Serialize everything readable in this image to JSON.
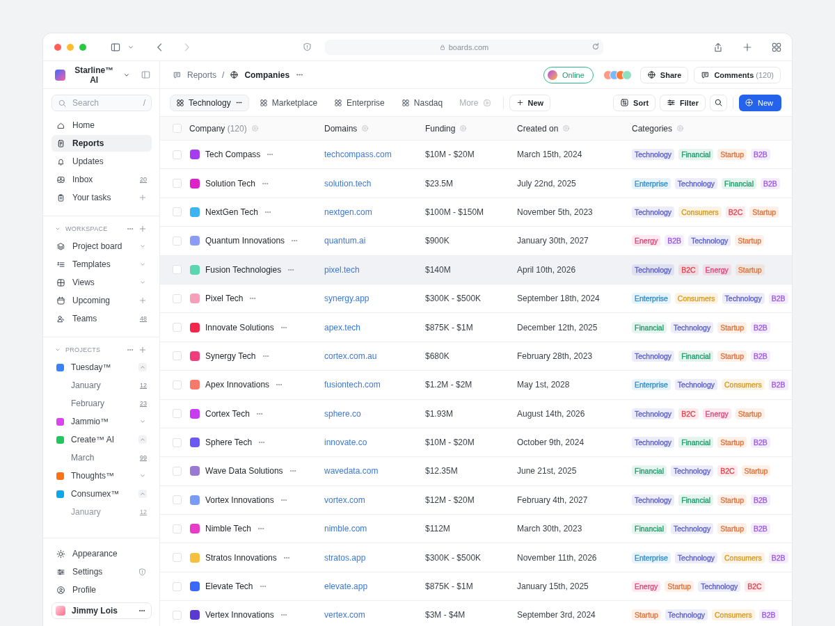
{
  "browser": {
    "url": "boards.com"
  },
  "sidebar": {
    "workspace": "Starline™ AI",
    "search": {
      "placeholder": "Search",
      "shortcut": "/"
    },
    "nav": [
      {
        "label": "Home",
        "selected": false
      },
      {
        "label": "Reports",
        "selected": true
      },
      {
        "label": "Updates",
        "selected": false
      },
      {
        "label": "Inbox",
        "selected": false,
        "count": "20"
      },
      {
        "label": "Your tasks",
        "selected": false,
        "kind": "add"
      }
    ],
    "sections": [
      {
        "title": "WORKSPACE",
        "items": [
          {
            "label": "Project board",
            "kind": "expand"
          },
          {
            "label": "Templates",
            "kind": "expand"
          },
          {
            "label": "Views",
            "kind": "expand"
          },
          {
            "label": "Upcoming",
            "kind": "add"
          },
          {
            "label": "Teams",
            "count": "48"
          }
        ]
      },
      {
        "title": "PROJECTS",
        "projects": [
          {
            "label": "Tuesday™",
            "color": "#3b82f6",
            "expanded": true,
            "children": [
              {
                "label": "January",
                "count": "12"
              },
              {
                "label": "February",
                "count": "23"
              }
            ]
          },
          {
            "label": "Jammio™",
            "color": "#d946ef",
            "expanded": false
          },
          {
            "label": "Create™ AI",
            "color": "#22c55e",
            "expanded": true,
            "children": [
              {
                "label": "March",
                "count": "99"
              }
            ]
          },
          {
            "label": "Thoughts™",
            "color": "#f97316",
            "expanded": false
          },
          {
            "label": "Consumex™",
            "color": "#0ea5e9",
            "expanded": true,
            "children": [
              {
                "label": "January",
                "count": "12"
              }
            ]
          }
        ]
      }
    ],
    "footer": [
      {
        "label": "Appearance"
      },
      {
        "label": "Settings",
        "kind": "secured"
      },
      {
        "label": "Profile"
      }
    ],
    "user": {
      "name": "Jimmy Lois"
    }
  },
  "topbar": {
    "breadcrumbs": [
      {
        "label": "Reports"
      },
      {
        "label": "Companies"
      }
    ],
    "separator": "/",
    "status": "Online",
    "share": "Share",
    "comments": {
      "label": "Comments",
      "count": "(120)"
    }
  },
  "tabs": [
    {
      "label": "Technology",
      "selected": true
    },
    {
      "label": "Marketplace",
      "selected": false
    },
    {
      "label": "Enterprise",
      "selected": false
    },
    {
      "label": "Nasdaq",
      "selected": false
    },
    {
      "label": "More",
      "selected": false,
      "disabled": true
    }
  ],
  "toolbar": {
    "new_view": "New",
    "sort": "Sort",
    "filter": "Filter",
    "primary": "New"
  },
  "table": {
    "columns": [
      {
        "label": "Company",
        "count": "(120)"
      },
      {
        "label": "Domains"
      },
      {
        "label": "Funding"
      },
      {
        "label": "Created on"
      },
      {
        "label": "Categories"
      }
    ],
    "select_all": {
      "checked": false
    },
    "rows": [
      {
        "company": "Tech Compass",
        "color": "#a43cf0",
        "domain": "techcompass.com",
        "funding": "$10M - $20M",
        "created": "March 15th, 2024",
        "selected": false,
        "checked": false,
        "tags": [
          {
            "label": "Technology",
            "color": "#5b5fc7"
          },
          {
            "label": "Financial",
            "color": "#1f9d6b"
          },
          {
            "label": "Startup",
            "color": "#e0723a"
          },
          {
            "label": "B2B",
            "color": "#9b59e0"
          }
        ]
      },
      {
        "company": "Solution Tech",
        "color": "#e020c8",
        "domain": "solution.tech",
        "funding": "$23.5M",
        "created": "July 22nd, 2025",
        "selected": false,
        "checked": false,
        "tags": [
          {
            "label": "Enterprise",
            "color": "#2e8fd0"
          },
          {
            "label": "Technology",
            "color": "#5b5fc7"
          },
          {
            "label": "Financial",
            "color": "#1f9d6b"
          },
          {
            "label": "B2B",
            "color": "#9b59e0"
          }
        ]
      },
      {
        "company": "NextGen Tech",
        "color": "#3cb4f0",
        "domain": "nextgen.com",
        "funding": "$100M - $150M",
        "created": "November 5th, 2023",
        "selected": false,
        "checked": false,
        "tags": [
          {
            "label": "Technology",
            "color": "#5b5fc7"
          },
          {
            "label": "Consumers",
            "color": "#d99a1e"
          },
          {
            "label": "B2C",
            "color": "#e0444f"
          },
          {
            "label": "Startup",
            "color": "#e0723a"
          }
        ]
      },
      {
        "company": "Quantum Innovations",
        "color": "#8a9cf5",
        "domain": "quantum.ai",
        "funding": "$900K",
        "created": "January 30th, 2027",
        "selected": false,
        "checked": false,
        "tags": [
          {
            "label": "Energy",
            "color": "#e0447a"
          },
          {
            "label": "B2B",
            "color": "#9b59e0"
          },
          {
            "label": "Technology",
            "color": "#5b5fc7"
          },
          {
            "label": "Startup",
            "color": "#e0723a"
          }
        ]
      },
      {
        "company": "Fusion Technologies",
        "color": "#5ad6b0",
        "domain": "pixel.tech",
        "funding": "$140M",
        "created": "April 10th, 2026",
        "selected": true,
        "checked": false,
        "tags": [
          {
            "label": "Technology",
            "color": "#5b5fc7"
          },
          {
            "label": "B2C",
            "color": "#e0444f"
          },
          {
            "label": "Energy",
            "color": "#e0447a"
          },
          {
            "label": "Startup",
            "color": "#e0723a"
          }
        ]
      },
      {
        "company": "Pixel Tech",
        "color": "#f5a0b8",
        "domain": "synergy.app",
        "funding": "$300K - $500K",
        "created": "September 18th, 2024",
        "selected": false,
        "checked": false,
        "tags": [
          {
            "label": "Enterprise",
            "color": "#2e8fd0"
          },
          {
            "label": "Consumers",
            "color": "#d99a1e"
          },
          {
            "label": "Technology",
            "color": "#5b5fc7"
          },
          {
            "label": "B2B",
            "color": "#9b59e0"
          }
        ]
      },
      {
        "company": "Innovate Solutions",
        "color": "#f0284a",
        "domain": "apex.tech",
        "funding": "$875K - $1M",
        "created": "December 12th, 2025",
        "selected": false,
        "checked": false,
        "tags": [
          {
            "label": "Financial",
            "color": "#1f9d6b"
          },
          {
            "label": "Technology",
            "color": "#5b5fc7"
          },
          {
            "label": "Startup",
            "color": "#e0723a"
          },
          {
            "label": "B2B",
            "color": "#9b59e0"
          }
        ]
      },
      {
        "company": "Synergy Tech",
        "color": "#f03c78",
        "domain": "cortex.com.au",
        "funding": "$680K",
        "created": "February 28th, 2023",
        "selected": false,
        "checked": false,
        "tags": [
          {
            "label": "Technology",
            "color": "#5b5fc7"
          },
          {
            "label": "Financial",
            "color": "#1f9d6b"
          },
          {
            "label": "Startup",
            "color": "#e0723a"
          },
          {
            "label": "B2B",
            "color": "#9b59e0"
          }
        ]
      },
      {
        "company": "Apex Innovations",
        "color": "#f57a6a",
        "domain": "fusiontech.com",
        "funding": "$1.2M - $2M",
        "created": "May 1st, 2028",
        "selected": false,
        "checked": false,
        "tags": [
          {
            "label": "Enterprise",
            "color": "#2e8fd0"
          },
          {
            "label": "Technology",
            "color": "#5b5fc7"
          },
          {
            "label": "Consumers",
            "color": "#d99a1e"
          },
          {
            "label": "B2B",
            "color": "#9b59e0"
          }
        ]
      },
      {
        "company": "Cortex Tech",
        "color": "#c83cf0",
        "domain": "sphere.co",
        "funding": "$1.93M",
        "created": "August 14th, 2026",
        "selected": false,
        "checked": false,
        "tags": [
          {
            "label": "Technology",
            "color": "#5b5fc7"
          },
          {
            "label": "B2C",
            "color": "#e0444f"
          },
          {
            "label": "Energy",
            "color": "#e0447a"
          },
          {
            "label": "Startup",
            "color": "#e0723a"
          }
        ]
      },
      {
        "company": "Sphere Tech",
        "color": "#6a5af0",
        "domain": "innovate.co",
        "funding": "$10M - $20M",
        "created": "October 9th, 2024",
        "selected": false,
        "checked": false,
        "tags": [
          {
            "label": "Technology",
            "color": "#5b5fc7"
          },
          {
            "label": "Financial",
            "color": "#1f9d6b"
          },
          {
            "label": "Startup",
            "color": "#e0723a"
          },
          {
            "label": "B2B",
            "color": "#9b59e0"
          }
        ]
      },
      {
        "company": "Wave Data Solutions",
        "color": "#9a7ad0",
        "domain": "wavedata.com",
        "funding": "$12.35M",
        "created": "June 21st, 2025",
        "selected": false,
        "checked": false,
        "tags": [
          {
            "label": "Financial",
            "color": "#1f9d6b"
          },
          {
            "label": "Technology",
            "color": "#5b5fc7"
          },
          {
            "label": "B2C",
            "color": "#e0444f"
          },
          {
            "label": "Startup",
            "color": "#e0723a"
          }
        ]
      },
      {
        "company": "Vortex Innovations",
        "color": "#7a9cf5",
        "domain": "vortex.com",
        "funding": "$12M - $20M",
        "created": "February 4th, 2027",
        "selected": false,
        "checked": false,
        "tags": [
          {
            "label": "Technology",
            "color": "#5b5fc7"
          },
          {
            "label": "Financial",
            "color": "#1f9d6b"
          },
          {
            "label": "Startup",
            "color": "#e0723a"
          },
          {
            "label": "B2B",
            "color": "#9b59e0"
          }
        ]
      },
      {
        "company": "Nimble Tech",
        "color": "#e83cc8",
        "domain": "nimble.com",
        "funding": "$112M",
        "created": "March 30th, 2023",
        "selected": false,
        "checked": false,
        "tags": [
          {
            "label": "Financial",
            "color": "#1f9d6b"
          },
          {
            "label": "Technology",
            "color": "#5b5fc7"
          },
          {
            "label": "Startup",
            "color": "#e0723a"
          },
          {
            "label": "B2B",
            "color": "#9b59e0"
          }
        ]
      },
      {
        "company": "Stratos Innovations",
        "color": "#f5c040",
        "domain": "stratos.app",
        "funding": "$300K - $500K",
        "created": "November 11th, 2026",
        "selected": false,
        "checked": false,
        "tags": [
          {
            "label": "Enterprise",
            "color": "#2e8fd0"
          },
          {
            "label": "Technology",
            "color": "#5b5fc7"
          },
          {
            "label": "Consumers",
            "color": "#d99a1e"
          },
          {
            "label": "B2B",
            "color": "#9b59e0"
          }
        ]
      },
      {
        "company": "Elevate Tech",
        "color": "#3a6af5",
        "domain": "elevate.app",
        "funding": "$875K - $1M",
        "created": "January 15th, 2025",
        "selected": false,
        "checked": false,
        "tags": [
          {
            "label": "Energy",
            "color": "#e0447a"
          },
          {
            "label": "Startup",
            "color": "#e0723a"
          },
          {
            "label": "Technology",
            "color": "#5b5fc7"
          },
          {
            "label": "B2C",
            "color": "#e0444f"
          }
        ]
      },
      {
        "company": "Vertex Innovations",
        "color": "#5a3ad0",
        "domain": "vertex.com",
        "funding": "$3M - $4M",
        "created": "September 3rd, 2024",
        "selected": false,
        "checked": false,
        "tags": [
          {
            "label": "Startup",
            "color": "#e0723a"
          },
          {
            "label": "Technology",
            "color": "#5b5fc7"
          },
          {
            "label": "Consumers",
            "color": "#d99a1e"
          },
          {
            "label": "B2B",
            "color": "#9b59e0"
          }
        ]
      }
    ]
  }
}
